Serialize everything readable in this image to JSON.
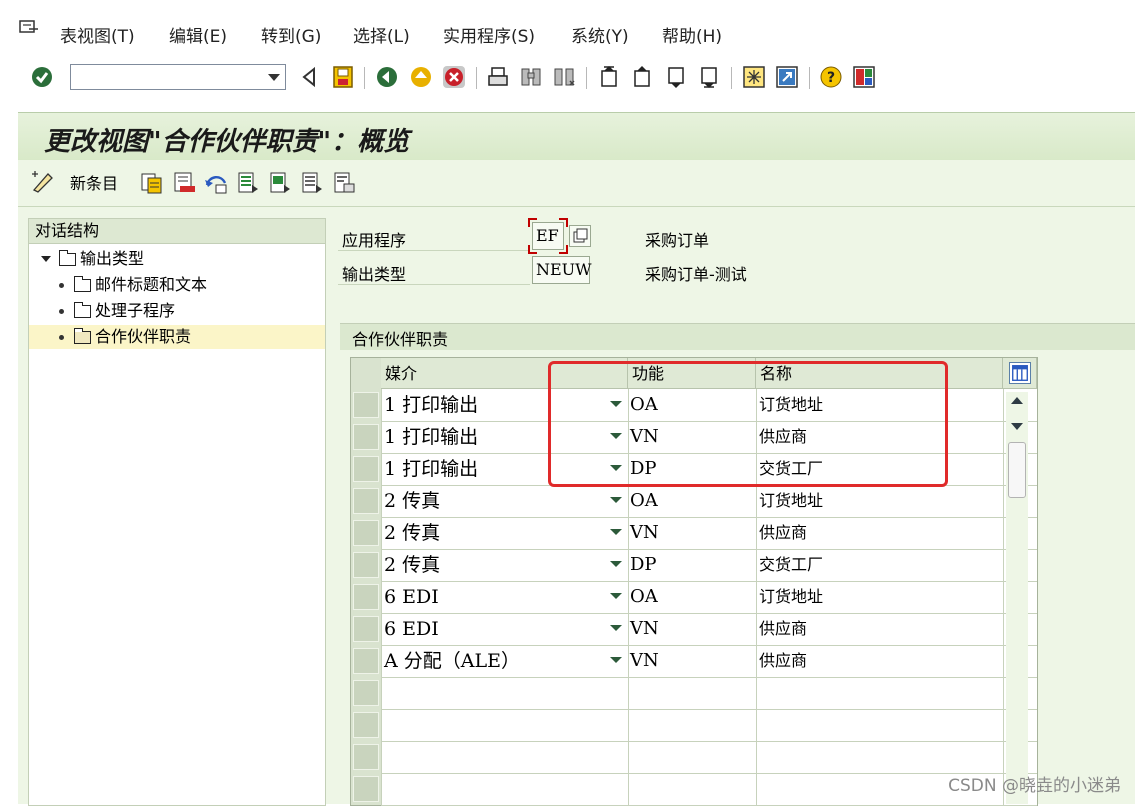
{
  "menu": {
    "items": [
      "表视图(T)",
      "编辑(E)",
      "转到(G)",
      "选择(L)",
      "实用程序(S)",
      "系统(Y)",
      "帮助(H)"
    ]
  },
  "toolbar": {
    "command_field_value": "",
    "icons": [
      "enter-icon",
      "back-arrow-icon",
      "save-icon",
      "back-icon",
      "exit-icon",
      "cancel-icon",
      "print-icon",
      "find-icon",
      "find-next-icon",
      "first-page-icon",
      "previous-page-icon",
      "next-page-icon",
      "last-page-icon",
      "create-session-icon",
      "shortcut-icon",
      "help-icon",
      "layout-icon"
    ]
  },
  "page": {
    "title": "更改视图\"合作伙伴职责\"：概览"
  },
  "app_toolbar": {
    "new_entries_label": "新条目"
  },
  "nav": {
    "header": "对话结构",
    "items": [
      "输出类型",
      "邮件标题和文本",
      "处理子程序",
      "合作伙伴职责"
    ],
    "selected": "合作伙伴职责"
  },
  "header_fields": {
    "application_label": "应用程序",
    "application_value": "EF",
    "application_text": "采购订单",
    "output_type_label": "输出类型",
    "output_type_value": "NEUW",
    "output_type_text": "采购订单-测试"
  },
  "group": {
    "title": "合作伙伴职责"
  },
  "table": {
    "columns": [
      "媒介",
      "功能",
      "名称"
    ],
    "rows": [
      {
        "medium": "1 打印输出",
        "function": "OA",
        "name": "订货地址"
      },
      {
        "medium": "1 打印输出",
        "function": "VN",
        "name": "供应商"
      },
      {
        "medium": "1 打印输出",
        "function": "DP",
        "name": "交货工厂"
      },
      {
        "medium": "2 传真",
        "function": "OA",
        "name": "订货地址"
      },
      {
        "medium": "2 传真",
        "function": "VN",
        "name": "供应商"
      },
      {
        "medium": "2 传真",
        "function": "DP",
        "name": "交货工厂"
      },
      {
        "medium": "6 EDI",
        "function": "OA",
        "name": "订货地址"
      },
      {
        "medium": "6 EDI",
        "function": "VN",
        "name": "供应商"
      },
      {
        "medium": "A 分配（ALE）",
        "function": "VN",
        "name": "供应商"
      }
    ]
  },
  "watermark": "CSDN @晓垚的小迷弟",
  "colors": {
    "highlight": "#e02a2a",
    "selected_row": "#fbf5c8",
    "panel_bg": "#eef6e6"
  }
}
